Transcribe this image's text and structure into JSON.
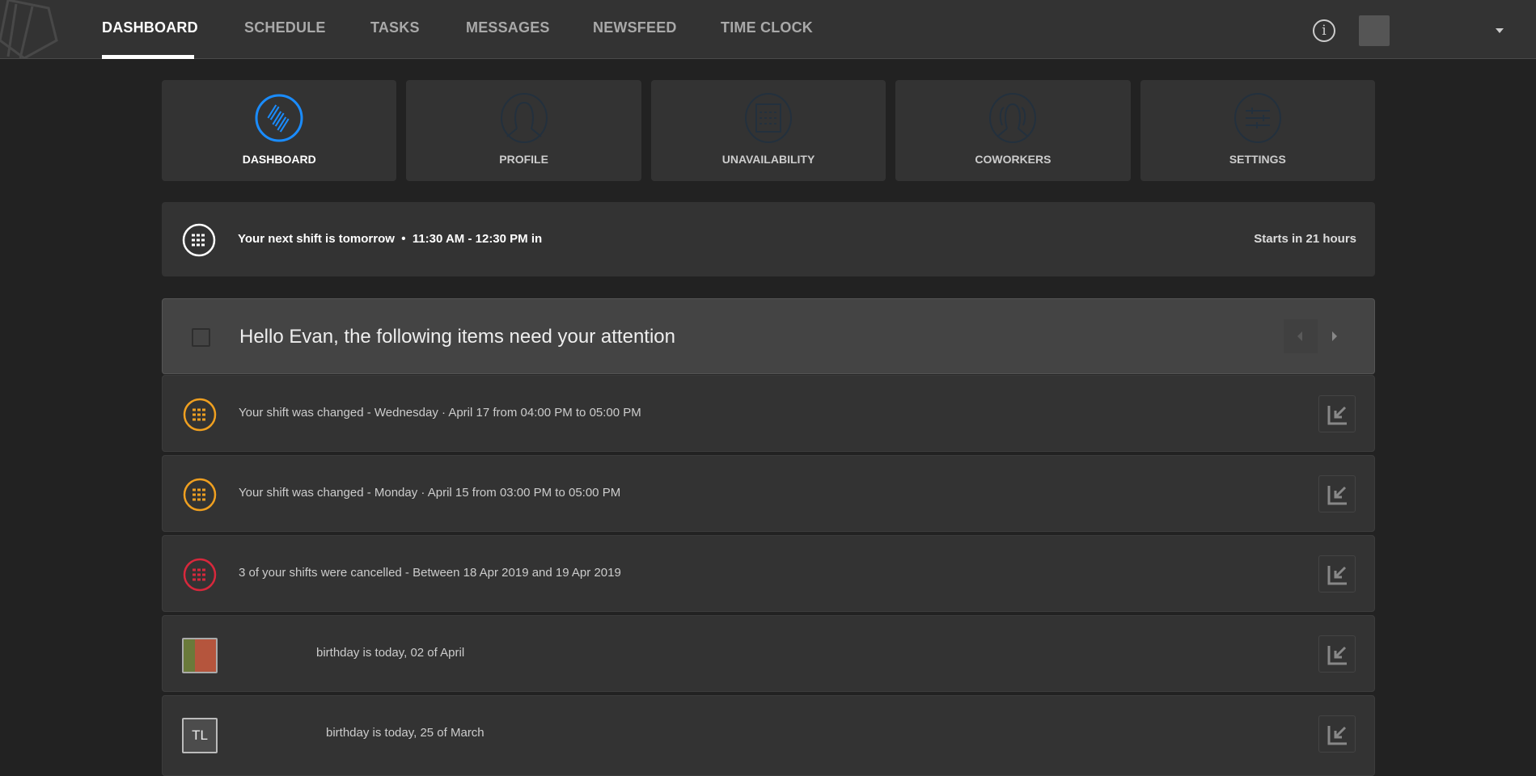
{
  "nav": {
    "tabs": [
      "DASHBOARD",
      "SCHEDULE",
      "TASKS",
      "MESSAGES",
      "NEWSFEED",
      "TIME CLOCK"
    ],
    "active": "DASHBOARD",
    "info_icon": "i"
  },
  "cards": [
    {
      "label": "DASHBOARD",
      "icon": "dashboard-icon"
    },
    {
      "label": "PROFILE",
      "icon": "profile-icon"
    },
    {
      "label": "UNAVAILABILITY",
      "icon": "calendar-icon"
    },
    {
      "label": "COWORKERS",
      "icon": "coworkers-icon"
    },
    {
      "label": "SETTINGS",
      "icon": "sliders-icon"
    }
  ],
  "next_shift": {
    "text": "Your next shift is tomorrow  •  11:30 AM - 12:30 PM in",
    "starts": "Starts in 21 hours"
  },
  "attention": {
    "title": "Hello Evan, the following items need your attention",
    "items": [
      {
        "type": "shift-changed",
        "text": "Your shift was changed - Wednesday · April 17 from 04:00 PM to 05:00 PM",
        "color": "#f0a020"
      },
      {
        "type": "shift-changed",
        "text": "Your shift was changed - Monday · April 15 from 03:00 PM to 05:00 PM",
        "color": "#f0a020"
      },
      {
        "type": "shift-cancelled",
        "text": "3 of your shifts were cancelled - Between 18 Apr 2019 and 19 Apr 2019",
        "color": "#d8283c"
      },
      {
        "type": "birthday",
        "text": "birthday is today, 02 of April"
      },
      {
        "type": "birthday",
        "text": "birthday is today, 25 of March",
        "initials": "TL"
      }
    ]
  },
  "colors": {
    "accent": "#1a8cff",
    "muted_icon": "#23303d"
  }
}
